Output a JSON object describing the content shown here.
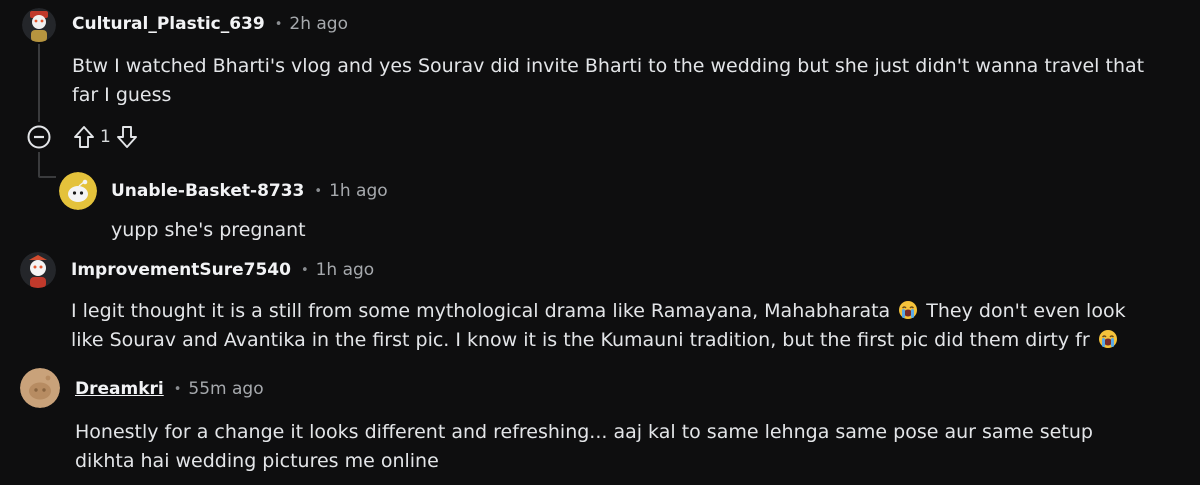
{
  "comments": [
    {
      "username": "Cultural_Plastic_639",
      "time": "2h ago",
      "lines": [
        "Btw I watched Bharti's vlog and yes Sourav did invite Bharti to the wedding but she just didn't wanna travel that",
        "far I guess"
      ],
      "votes": "1"
    },
    {
      "username": "Unable-Basket-8733",
      "time": "1h ago",
      "lines": [
        "yupp she's pregnant"
      ]
    },
    {
      "username": "ImprovementSure7540",
      "time": "1h ago",
      "lines": [
        "I legit thought it is a still from some mythological drama like Ramayana, Mahabharata",
        "They don't even look",
        "like Sourav and Avantika in the first pic. I know it is the Kumauni tradition, but the first pic did them dirty fr"
      ]
    },
    {
      "username": "Dreamkri",
      "time": "55m ago",
      "lines": [
        "Honestly for a change it looks different and refreshing... aaj kal to same lehnga same pose aur same setup",
        "dikhta hai wedding pictures me online"
      ]
    }
  ],
  "separator": "•",
  "icons": {
    "collapse": "collapse-circle-icon",
    "upvote": "upvote-arrow-icon",
    "downvote": "downvote-arrow-icon",
    "emoji": "loudly-crying-emoji-icon"
  }
}
